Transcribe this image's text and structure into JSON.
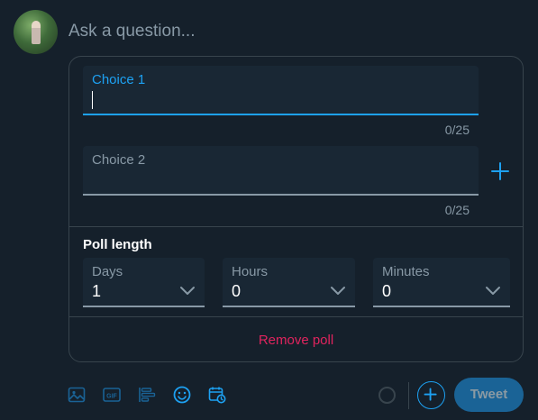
{
  "composer": {
    "placeholder": "Ask a question..."
  },
  "poll": {
    "choices": [
      {
        "label": "Choice 1",
        "value": "",
        "counter": "0/25",
        "focused": true
      },
      {
        "label": "Choice 2",
        "value": "",
        "counter": "0/25",
        "focused": false
      }
    ],
    "add_choice_icon": "plus-icon",
    "length_title": "Poll length",
    "length": {
      "days": {
        "label": "Days",
        "value": "1"
      },
      "hours": {
        "label": "Hours",
        "value": "0"
      },
      "minutes": {
        "label": "Minutes",
        "value": "0"
      }
    },
    "remove_label": "Remove poll"
  },
  "toolbar": {
    "icons": [
      "image-icon",
      "gif-icon",
      "poll-icon",
      "emoji-icon",
      "schedule-icon"
    ],
    "gif_text": "GIF",
    "tweet_label": "Tweet",
    "add_icon": "plus-circle-icon"
  },
  "colors": {
    "background": "#15202b",
    "accent": "#1da1f2",
    "field": "#192734",
    "border": "#38444d",
    "muted": "#8899a6",
    "danger": "#e0245e",
    "tweet_button_disabled": "#1a6396"
  }
}
